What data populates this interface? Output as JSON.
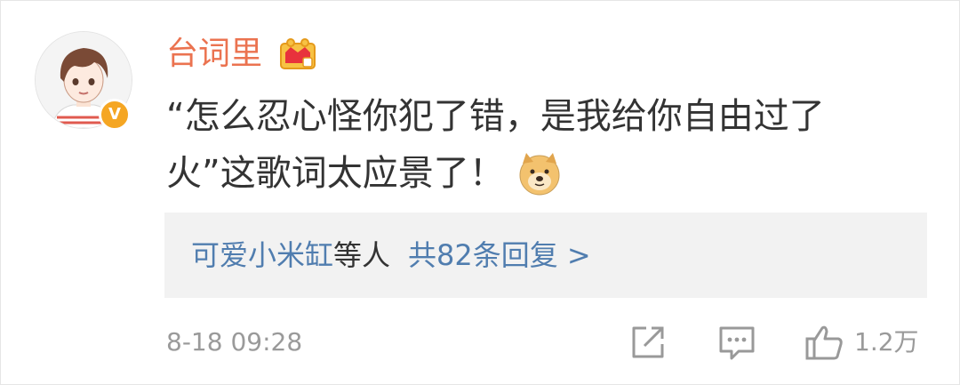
{
  "user": {
    "name": "台词里",
    "badge_icon": "crown-icon",
    "avatar_icon": "avatar-icon",
    "verified_icon": "verified-icon",
    "verified_label": "V"
  },
  "comment": {
    "text": "“怎么忍心怪你犯了错，是我给你自由过了火”这歌词太应景了！",
    "emoji_icon": "doge-icon"
  },
  "replies": {
    "users": "可爱小米缸",
    "suffix": "等人",
    "count_text": "共82条回复 >"
  },
  "footer": {
    "timestamp": "8-18 09:28",
    "like_count": "1.2万",
    "icons": [
      "share-icon",
      "comment-icon",
      "like-icon"
    ]
  },
  "colors": {
    "username": "#eb7350",
    "link": "#507daf",
    "text": "#333333",
    "meta": "#9a9a9a",
    "reply_bg": "#f2f2f2",
    "verified": "#f5a623"
  }
}
